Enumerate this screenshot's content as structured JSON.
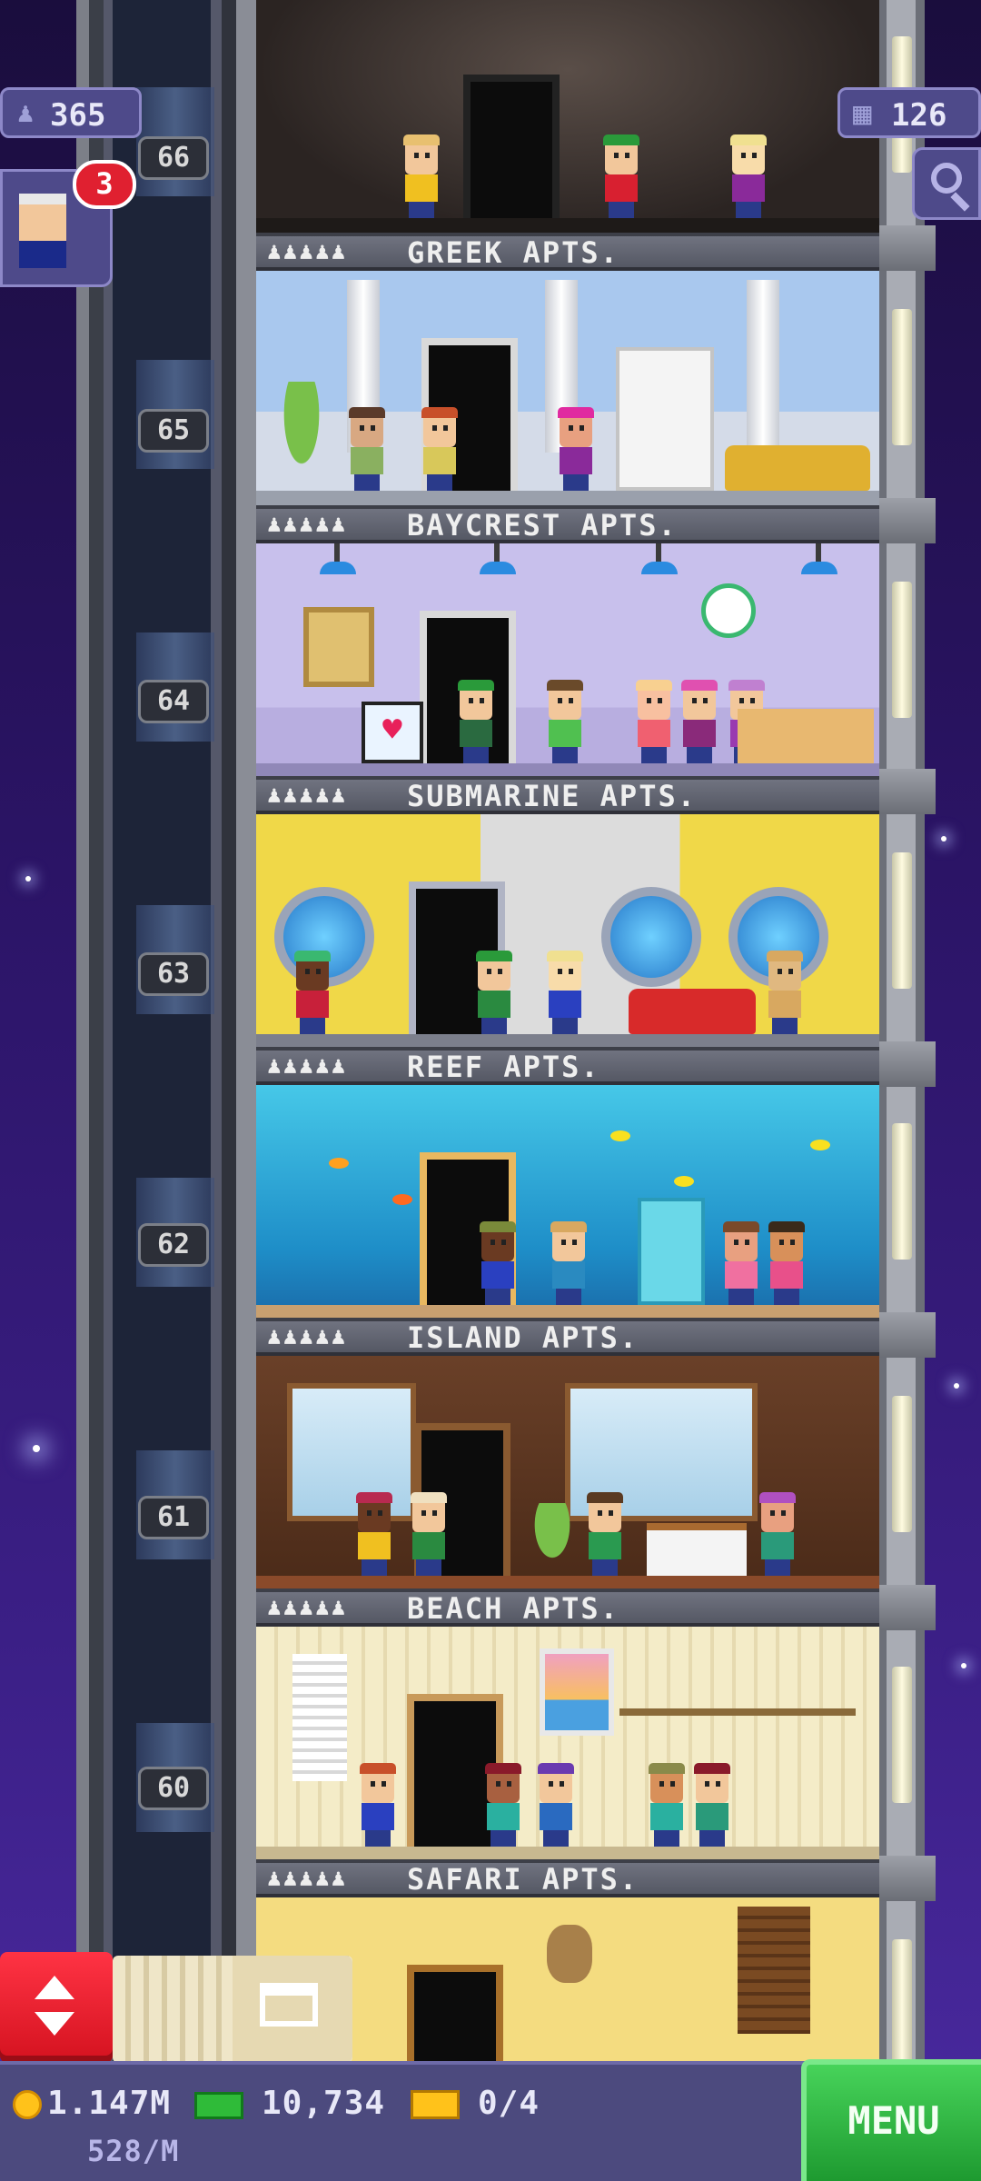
{
  "hud": {
    "population": "365",
    "floors": "126",
    "visitor_badge_count": "3",
    "population_icon": "people-icon",
    "floors_icon": "building-icon"
  },
  "floors": [
    {
      "number": "66",
      "sign_people": "♟♟♟♟♟",
      "name": "GREEK APTS."
    },
    {
      "number": "65",
      "sign_people": "♟♟♟♟♟",
      "name": "BAYCREST APTS."
    },
    {
      "number": "64",
      "sign_people": "♟♟♟♟♟",
      "name": "SUBMARINE APTS."
    },
    {
      "number": "63",
      "sign_people": "♟♟♟♟♟",
      "name": "REEF APTS."
    },
    {
      "number": "62",
      "sign_people": "♟♟♟♟♟",
      "name": "ISLAND APTS."
    },
    {
      "number": "61",
      "sign_people": "♟♟♟♟♟",
      "name": "BEACH APTS."
    },
    {
      "number": "60",
      "sign_people": "♟♟♟♟♟",
      "name": "SAFARI APTS."
    }
  ],
  "status_bar": {
    "coins": "1.147M",
    "coins_rate": "528/M",
    "bux": "10,734",
    "tickets": "0/4",
    "menu_label": "MENU"
  },
  "colors": {
    "accent_red": "#e02030",
    "menu_green": "#2fbb39",
    "hud_purple": "#4e4a8a",
    "coin_gold": "#ffc21a"
  }
}
